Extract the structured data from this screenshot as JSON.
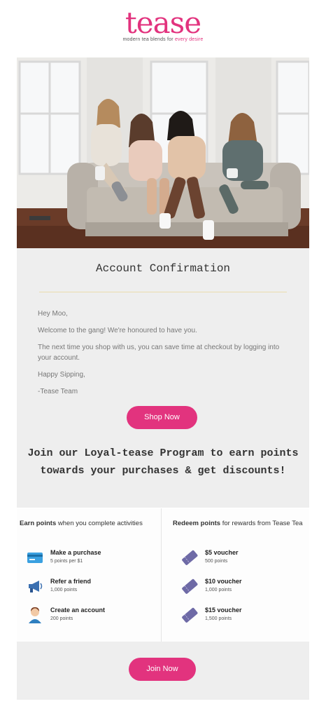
{
  "header": {
    "logo_text": "tease",
    "tagline_prefix": "modern tea blends for ",
    "tagline_accent": "every desire"
  },
  "hero": {
    "image": "four women sitting on a sofa drinking tea"
  },
  "confirmation": {
    "title": "Account Confirmation",
    "greeting": "Hey Moo,",
    "line1": "Welcome to the gang! We're honoured to have you.",
    "line2": "The next time you shop with us, you can save time at checkout by logging into your account.",
    "line3": "Happy Sipping,",
    "signoff": "-Tease Team",
    "shop_button": "Shop Now"
  },
  "loyalty": {
    "heading": "Join our Loyal-tease Program to earn points towards your purchases & get discounts!"
  },
  "earn": {
    "heading_bold": "Earn points",
    "heading_rest": " when you complete activities",
    "items": [
      {
        "title": "Make a purchase",
        "points": "5 points per $1",
        "icon": "credit-card-icon"
      },
      {
        "title": "Refer a friend",
        "points": "1,000 points",
        "icon": "megaphone-icon"
      },
      {
        "title": "Create an account",
        "points": "200 points",
        "icon": "person-icon"
      }
    ]
  },
  "redeem": {
    "heading_bold": "Redeem points",
    "heading_rest": " for rewards from Tease Tea",
    "items": [
      {
        "title": "$5 voucher",
        "points": "500 points",
        "icon": "ticket-icon"
      },
      {
        "title": "$10 voucher",
        "points": "1,000 points",
        "icon": "ticket-icon"
      },
      {
        "title": "$15 voucher",
        "points": "1,500 points",
        "icon": "ticket-icon"
      }
    ]
  },
  "footer": {
    "join_button": "Join Now"
  },
  "colors": {
    "brand": "#e2337e",
    "card_bg": "#eeeeee",
    "divider": "#eadcae",
    "ticket": "#6e6aa6",
    "card_icon": "#3aa0e0"
  }
}
